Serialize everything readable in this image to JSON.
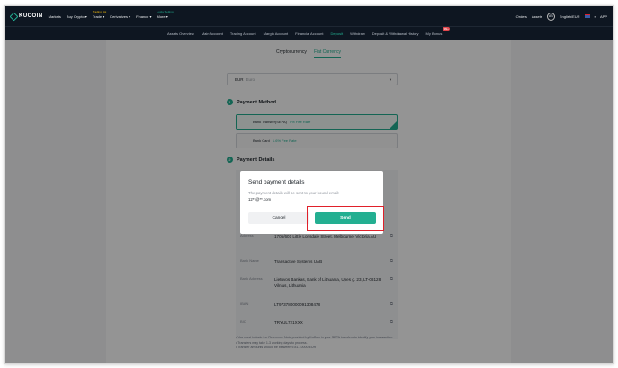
{
  "header": {
    "logo": "KUCOIN",
    "nav": [
      {
        "label": "Markets",
        "tag": ""
      },
      {
        "label": "Buy Crypto ▾",
        "tag": ""
      },
      {
        "label": "Trade ▾",
        "tag": "Trading Bot"
      },
      {
        "label": "Derivatives ▾",
        "tag": ""
      },
      {
        "label": "Finance ▾",
        "tag": ""
      },
      {
        "label": "More ▾",
        "tag": "Lucky Betting"
      }
    ],
    "right": {
      "orders": "Orders",
      "assets": "Assets",
      "avatar": "AB",
      "lang": "English/EUR",
      "app": "APP"
    }
  },
  "subnav": {
    "items": [
      "Assets Overview",
      "Main Account",
      "Trading Account",
      "Margin Account",
      "Financial Account",
      "Deposit",
      "Withdraw",
      "Deposit & Withdrawal History",
      "My Bonus"
    ],
    "active_index": 5,
    "bonus_badge": "99+"
  },
  "tabs": {
    "crypto": "Cryptocurrency",
    "fiat": "Fiat Currency"
  },
  "currency": {
    "code": "EUR",
    "name": "Euro"
  },
  "payment_method": {
    "step": "1",
    "title": "Payment Method",
    "options": [
      {
        "label": "Bank Transfer(SEPA)",
        "fee": "0% Fee Rate"
      },
      {
        "label": "Bank Card",
        "fee": "1.6% Fee Rate"
      }
    ]
  },
  "payment_details": {
    "step": "2",
    "title": "Payment Details",
    "rows": [
      {
        "label": "Address",
        "value": "1705/601 Little Lonsdale Street, Melbourne, Victoria,AU"
      },
      {
        "label": "Bank Name",
        "value": "Transactive Systems UAB"
      },
      {
        "label": "Bank Address",
        "value": "Lietuvos Bankas, Bank of Lithuania, Upes g. 23, LT-08128, Vilnius, Lithuania"
      },
      {
        "label": "IBAN",
        "value": "LT973780000091308478"
      },
      {
        "label": "BIC",
        "value": "TRYUL721XXX"
      }
    ]
  },
  "notes": {
    "n1": "You must include the Reference Note provided by KuCoin in your SEPA transfers to identify your transaction.",
    "n2": "Transfers may take 1-3 working days to process.",
    "n3": "Transfer amounts should be between 9.81-10000 EUR"
  },
  "modal": {
    "title": "Send payment details",
    "desc": "The payment details will be sent to your bound email:",
    "email": "12**@**.com",
    "cancel": "Cancel",
    "send": "Send"
  }
}
